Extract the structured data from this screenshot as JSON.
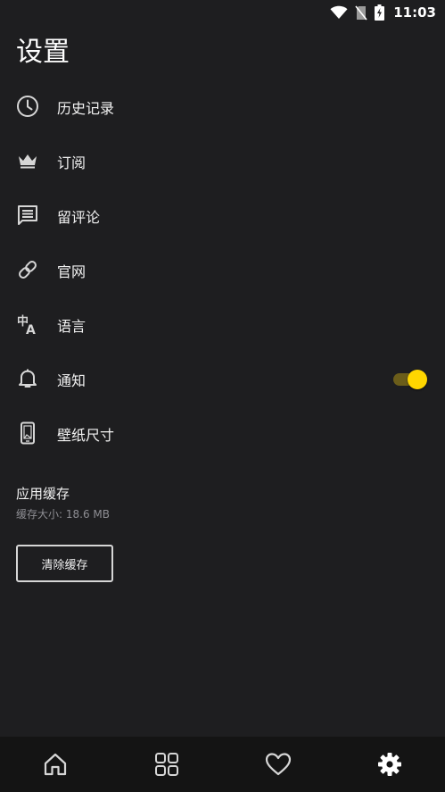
{
  "status_bar": {
    "time": "11:03",
    "icons": [
      "wifi-icon",
      "no-sim-icon",
      "battery-charging-icon"
    ]
  },
  "page": {
    "title": "设置"
  },
  "settings": {
    "items": [
      {
        "label": "历史记录",
        "icon": "history-icon"
      },
      {
        "label": "订阅",
        "icon": "crown-icon"
      },
      {
        "label": "留评论",
        "icon": "comment-icon"
      },
      {
        "label": "官网",
        "icon": "link-icon"
      },
      {
        "label": "语言",
        "icon": "translate-icon"
      },
      {
        "label": "通知",
        "icon": "bell-icon",
        "toggle": true
      },
      {
        "label": "壁纸尺寸",
        "icon": "phone-icon"
      }
    ]
  },
  "cache": {
    "title": "应用缓存",
    "size_text": "缓存大小: 18.6 MB",
    "clear_button": "清除缓存"
  },
  "bottom_nav": {
    "items": [
      {
        "icon": "home-icon",
        "active": false
      },
      {
        "icon": "grid-icon",
        "active": false
      },
      {
        "icon": "heart-icon",
        "active": false
      },
      {
        "icon": "settings-gear-icon",
        "active": true
      }
    ]
  },
  "colors": {
    "background": "#1e1e20",
    "accent": "#ffd600",
    "bottom_nav_bg": "#141414",
    "secondary_text": "#8e8e93"
  }
}
